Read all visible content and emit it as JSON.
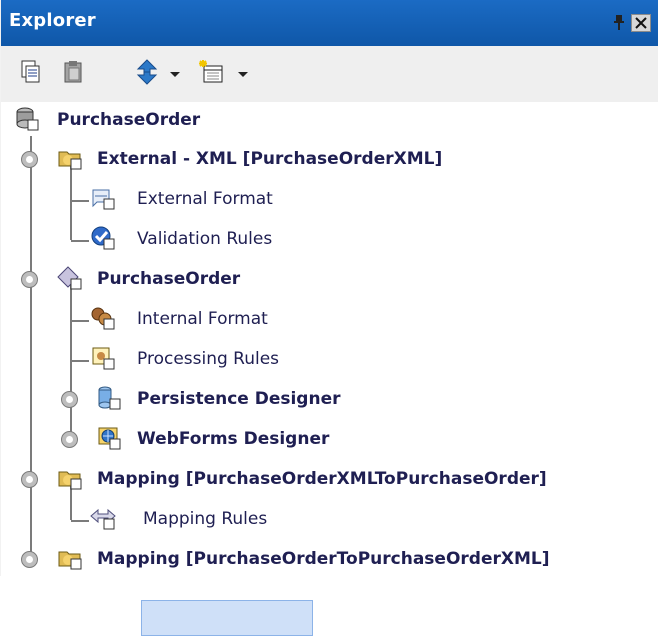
{
  "window": {
    "title": "Explorer"
  },
  "tree": {
    "root": "PurchaseOrder",
    "nodes": [
      {
        "label": "External - XML [PurchaseOrderXML]"
      },
      {
        "label": "External Format"
      },
      {
        "label": "Validation Rules"
      },
      {
        "label": "PurchaseOrder"
      },
      {
        "label": "Internal Format"
      },
      {
        "label": "Processing Rules"
      },
      {
        "label": "Persistence Designer"
      },
      {
        "label": "WebForms Designer"
      },
      {
        "label": "Mapping [PurchaseOrderXMLToPurchaseOrder]"
      },
      {
        "label": "Mapping Rules"
      },
      {
        "label": "Mapping [PurchaseOrderToPurchaseOrderXML]"
      }
    ]
  },
  "toolbar": {
    "buttons": [
      {
        "icon": "copy-icon"
      },
      {
        "icon": "paste-icon"
      },
      {
        "icon": "navigate-icon"
      },
      {
        "icon": "dropdown-icon"
      },
      {
        "icon": "new-item-icon"
      },
      {
        "icon": "dropdown-icon"
      }
    ]
  },
  "colors": {
    "titlebar": "#1b6bc4",
    "selection": "#cfe0f8",
    "text": "#1f1f52"
  }
}
